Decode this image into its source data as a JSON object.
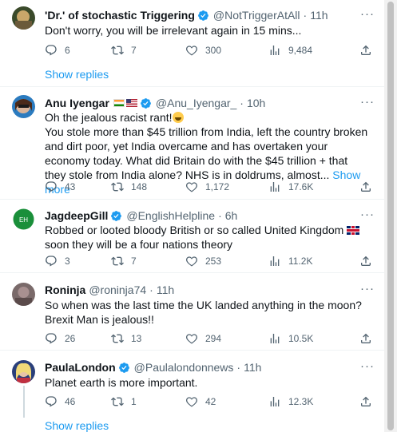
{
  "colors": {
    "accent": "#1d9bf0",
    "verified": "#1d9bf0",
    "muted": "#536471"
  },
  "tweets": [
    {
      "name": "'Dr.' of stochastic Triggering",
      "handle": "@NotTriggerAtAll",
      "time": "11h",
      "text": "Don't worry, you will be irrelevant again in 15 mins...",
      "replies": "6",
      "retweets": "7",
      "likes": "300",
      "views": "9,484"
    },
    {
      "name": "Anu Iyengar",
      "handle": "@Anu_Iyengar_",
      "time": "10h",
      "text_line1": "Oh the jealous racist rant!",
      "text_rest": "You stole more than $45 trillion from India, left the country broken and dirt poor, yet India overcame and has overtaken your economy today. What did Britain do with the $45 trillion + that they stole from India alone? NHS is in doldrums, almost...",
      "show_more": "Show more",
      "replies": "43",
      "retweets": "148",
      "likes": "1,172",
      "views": "17.6K"
    },
    {
      "name": "JagdeepGill",
      "handle": "@EnglishHelpline",
      "time": "6h",
      "text_before": "Robbed or looted bloody British or so called United Kingdom ",
      "text_after": "soon they will be a four nations theory",
      "replies": "3",
      "retweets": "7",
      "likes": "253",
      "views": "11.2K"
    },
    {
      "name": "Roninja",
      "handle": "@roninja74",
      "time": "11h",
      "text": "So when was the last time the UK landed anything in the moon? Brexit Man is jealous!!",
      "replies": "26",
      "retweets": "13",
      "likes": "294",
      "views": "10.5K"
    },
    {
      "name": "PaulaLondon",
      "handle": "@Paulalondonnews",
      "time": "11h",
      "text": "Planet earth is more important.",
      "replies": "46",
      "retweets": "1",
      "likes": "42",
      "views": "12.3K"
    }
  ],
  "show_replies": "Show replies",
  "more_dots": "···",
  "dot_sep": "·"
}
